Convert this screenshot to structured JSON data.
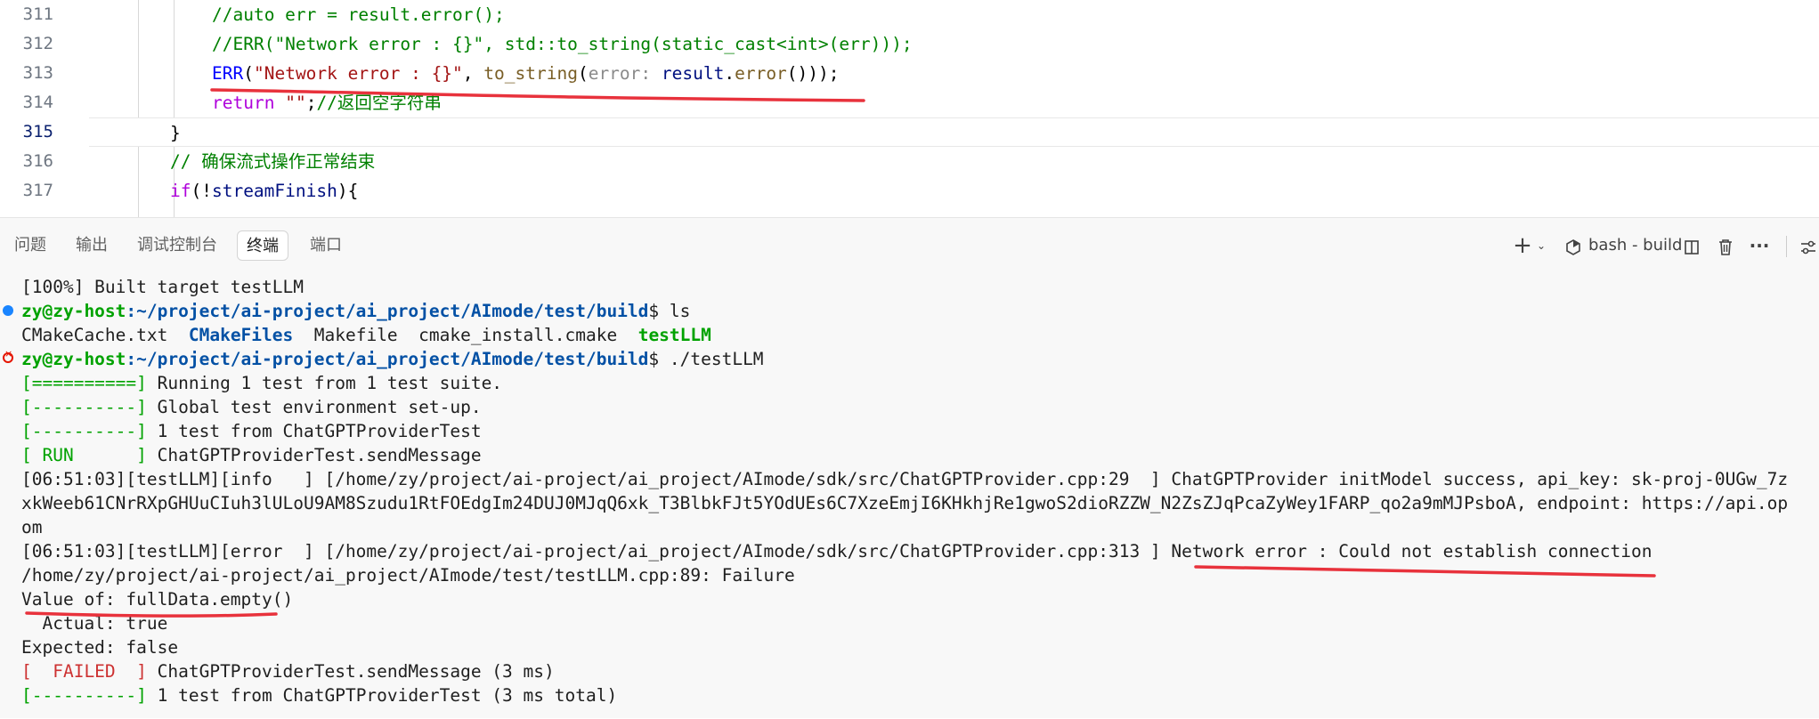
{
  "editor": {
    "lines": [
      {
        "num": "311",
        "tokens": [
          {
            "t": "//auto err = result.error();",
            "c": "c-comment"
          }
        ]
      },
      {
        "num": "312",
        "tokens": [
          {
            "t": "//ERR(\"Network error : {}\", std::to_string(static_cast<int>(err)));",
            "c": "c-comment"
          }
        ]
      },
      {
        "num": "313",
        "tokens": [
          {
            "t": "ERR",
            "c": "c-macro"
          },
          {
            "t": "(",
            "c": "c-punct"
          },
          {
            "t": "\"Network error : {}\"",
            "c": "c-string"
          },
          {
            "t": ", ",
            "c": "c-punct"
          },
          {
            "t": "to_string",
            "c": "c-func"
          },
          {
            "t": "(",
            "c": "c-punct"
          },
          {
            "t": "error: ",
            "c": "c-hint"
          },
          {
            "t": "result",
            "c": "c-var"
          },
          {
            "t": ".",
            "c": "c-punct"
          },
          {
            "t": "error",
            "c": "c-func"
          },
          {
            "t": "()));",
            "c": "c-punct"
          }
        ]
      },
      {
        "num": "314",
        "tokens": [
          {
            "t": "return",
            "c": "c-kw"
          },
          {
            "t": " ",
            "c": "c-punct"
          },
          {
            "t": "\"\"",
            "c": "c-string"
          },
          {
            "t": ";",
            "c": "c-punct"
          },
          {
            "t": "//返回空字符串",
            "c": "c-comment"
          }
        ]
      },
      {
        "num": "315",
        "tokens": [
          {
            "t": "}",
            "c": "c-punct"
          }
        ]
      },
      {
        "num": "316",
        "tokens": [
          {
            "t": "// 确保流式操作正常结束",
            "c": "c-comment"
          }
        ]
      },
      {
        "num": "317",
        "tokens": [
          {
            "t": "if",
            "c": "c-kw"
          },
          {
            "t": "(!",
            "c": "c-punct"
          },
          {
            "t": "streamFinish",
            "c": "c-var"
          },
          {
            "t": "){",
            "c": "c-punct"
          }
        ]
      }
    ]
  },
  "panel": {
    "tabs": [
      "问题",
      "输出",
      "调试控制台",
      "终端",
      "端口"
    ],
    "active_tab": "终端",
    "terminal_name": "bash - build",
    "icons": {
      "add": "plus-icon",
      "dropdown": "chevron-down-icon",
      "terminal": "terminal-shell-icon",
      "split": "split-terminal-icon",
      "kill": "trash-icon",
      "more": "more-actions-icon"
    }
  },
  "terminal": {
    "built": "[100%] Built target testLLM",
    "prompt1_user": "zy@zy-host",
    "prompt1_path": ":~/project/ai-project/ai_project/AImode/test/build",
    "prompt1_cmd": "$ ls",
    "ls_a": "CMakeCache.txt",
    "ls_b": "CMakeFiles",
    "ls_c": "Makefile",
    "ls_d": "cmake_install.cmake",
    "ls_e": "testLLM",
    "prompt2_user": "zy@zy-host",
    "prompt2_path": ":~/project/ai-project/ai_project/AImode/test/build",
    "prompt2_cmd": "$ ./testLLM",
    "g1_tag": "[==========]",
    "g1_text": " Running 1 test from 1 test suite.",
    "g2_tag": "[----------]",
    "g2_text": " Global test environment set-up.",
    "g3_tag": "[----------]",
    "g3_text": " 1 test from ChatGPTProviderTest",
    "g4_tag": "[ RUN      ]",
    "g4_text": " ChatGPTProviderTest.sendMessage",
    "log1": "[06:51:03][testLLM][info   ] [/home/zy/project/ai-project/ai_project/AImode/sdk/src/ChatGPTProvider.cpp:29  ] ChatGPTProvider initModel success, api_key: sk-proj-0UGw_7z",
    "log1b": "xkWeeb61CNrRXpGHUuCIuh3lULoU9AM8Szudu1RtFOEdgIm24DUJ0MJqQ6xk_T3BlbkFJt5YOdUEs6C7XzeEmjI6KHkhjRe1gwoS2dioRZZW_N2ZsZJqPcaZyWey1FARP_qo2a9mMJPsboA, endpoint: https://api.op",
    "log1c": "om",
    "log2": "[06:51:03][testLLM][error  ] [/home/zy/project/ai-project/ai_project/AImode/sdk/src/ChatGPTProvider.cpp:313 ] Network error : Could not establish connection",
    "fail_loc": "/home/zy/project/ai-project/ai_project/AImode/test/testLLM.cpp:89: Failure",
    "value_of": "Value of: fullData.empty()",
    "actual": "  Actual: true",
    "expected": "Expected: false",
    "f_tag": "[  FAILED  ]",
    "f_text": " ChatGPTProviderTest.sendMessage (3 ms)",
    "g5_tag": "[----------]",
    "g5_text": " 1 test from ChatGPTProviderTest (3 ms total)"
  },
  "colors": {
    "annotation": "#e8323c",
    "accent": "#1a85ff"
  }
}
